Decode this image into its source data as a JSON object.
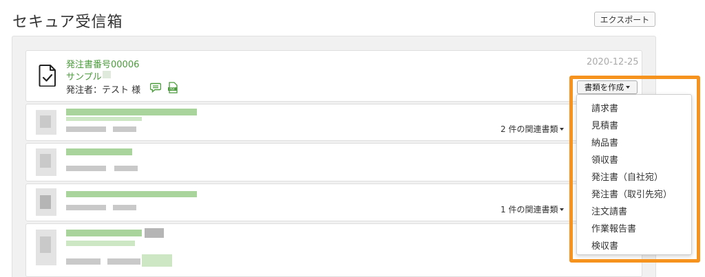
{
  "header": {
    "title": "セキュア受信箱",
    "export_label": "エクスポート"
  },
  "documents": [
    {
      "title": "発注書番号00006",
      "sample": "サンプル",
      "sender": "発注者：テスト 様",
      "date": "2020-12-25",
      "create_button": "書類を作成"
    }
  ],
  "related": [
    {
      "label": "2 件の関連書類"
    },
    {
      "label": "1 件の関連書類"
    }
  ],
  "dropdown": {
    "items": [
      "請求書",
      "見積書",
      "納品書",
      "領収書",
      "発注書（自社宛）",
      "発注書（取引先宛）",
      "注文請書",
      "作業報告書",
      "検収書"
    ]
  },
  "icons": {
    "document": "document-check-icon",
    "chat": "chat-icon",
    "pdf": "pdf-icon",
    "caret": "caret-down-icon"
  },
  "colors": {
    "link_green": "#4b9b3c",
    "highlight_orange": "#f6921e",
    "date_gray": "#aaaaaa"
  }
}
